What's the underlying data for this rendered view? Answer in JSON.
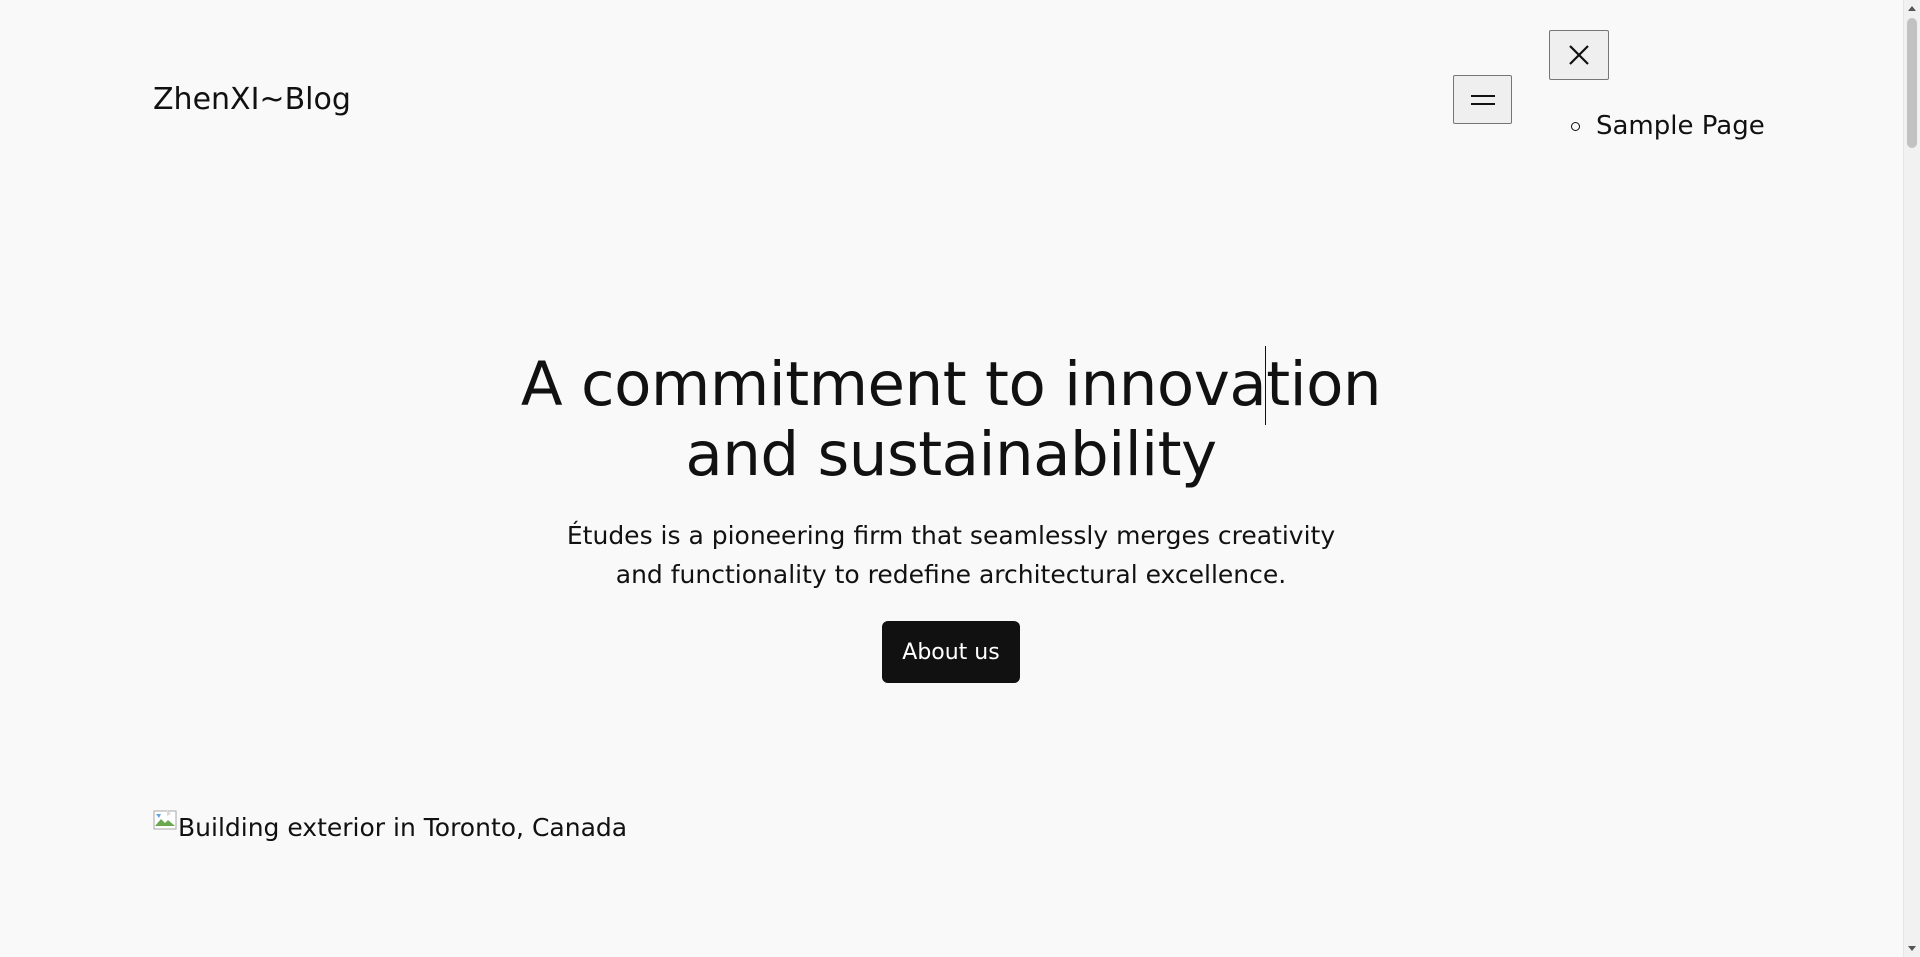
{
  "header": {
    "site_title": "ZhenXI~Blog",
    "menu_button_icon": "hamburger-menu-icon",
    "close_button_icon": "close-icon",
    "nav_items": [
      {
        "label": "Sample Page"
      }
    ]
  },
  "hero": {
    "title": "A commitment to innovation and sustainability",
    "description": "Études is a pioneering firm that seamlessly merges creativity and functionality to redefine architectural excellence.",
    "button_label": "About us"
  },
  "image": {
    "alt_text": "Building exterior in Toronto, Canada",
    "icon": "broken-image-icon"
  },
  "colors": {
    "background": "#f9f9f9",
    "text": "#111111",
    "button_background": "#111111",
    "button_text": "#ffffff"
  }
}
